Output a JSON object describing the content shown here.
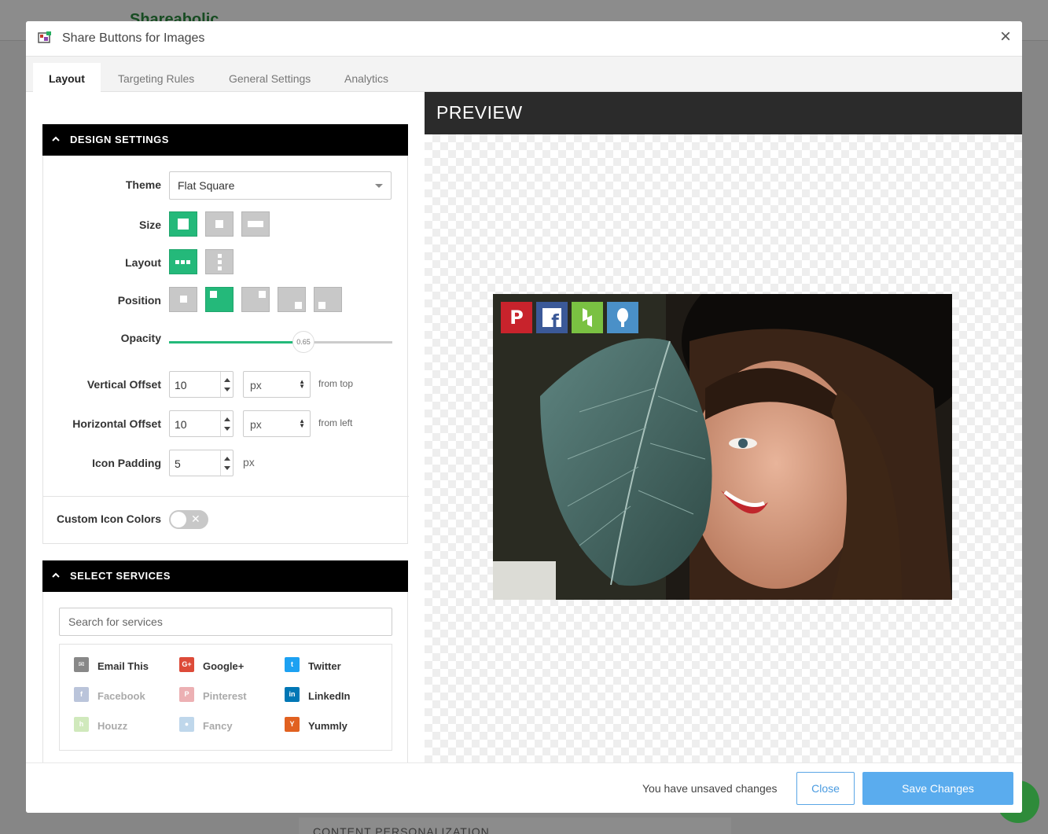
{
  "background": {
    "logo": "Shareabolic",
    "bottom_text": "CONTENT PERSONALIZATION"
  },
  "modal": {
    "title": "Share Buttons for Images",
    "tabs": [
      {
        "label": "Layout"
      },
      {
        "label": "Targeting Rules"
      },
      {
        "label": "General Settings"
      },
      {
        "label": "Analytics"
      }
    ],
    "active_tab": "Layout"
  },
  "design": {
    "header": "DESIGN SETTINGS",
    "theme_label": "Theme",
    "theme_value": "Flat Square",
    "size_label": "Size",
    "layout_label": "Layout",
    "position_label": "Position",
    "opacity_label": "Opacity",
    "opacity_value": "0.65",
    "vertical_offset_label": "Vertical Offset",
    "vertical_offset_value": "10",
    "vertical_offset_unit": "px",
    "vertical_offset_suffix": "from top",
    "horizontal_offset_label": "Horizontal Offset",
    "horizontal_offset_value": "10",
    "horizontal_offset_unit": "px",
    "horizontal_offset_suffix": "from left",
    "icon_padding_label": "Icon Padding",
    "icon_padding_value": "5",
    "icon_padding_unit": "px",
    "custom_colors_label": "Custom Icon Colors"
  },
  "services": {
    "header": "SELECT SERVICES",
    "search_placeholder": "Search for services",
    "items": [
      {
        "label": "Email This",
        "icon": "email-icon",
        "color": "#888888"
      },
      {
        "label": "Google+",
        "icon": "google-plus-icon",
        "color": "#dd4b39"
      },
      {
        "label": "Twitter",
        "icon": "twitter-icon",
        "color": "#1da1f2"
      },
      {
        "label": "Facebook",
        "icon": "facebook-icon",
        "color": "#3b5998"
      },
      {
        "label": "Pinterest",
        "icon": "pinterest-icon",
        "color": "#cb2027"
      },
      {
        "label": "LinkedIn",
        "icon": "linkedin-icon",
        "color": "#0077b5"
      },
      {
        "label": "Houzz",
        "icon": "houzz-icon",
        "color": "#7ac142"
      },
      {
        "label": "Fancy",
        "icon": "fancy-icon",
        "color": "#4a90c8"
      },
      {
        "label": "Yummly",
        "icon": "yummly-icon",
        "color": "#e16120"
      }
    ]
  },
  "preview": {
    "header": "PREVIEW",
    "share_icons": [
      {
        "icon": "pinterest-icon",
        "color": "#c8232c"
      },
      {
        "icon": "facebook-icon",
        "color": "#3b5998"
      },
      {
        "icon": "houzz-icon",
        "color": "#7ac142"
      },
      {
        "icon": "fancy-icon",
        "color": "#4a90c8"
      }
    ]
  },
  "footer": {
    "unsaved_text": "You have unsaved changes",
    "close_label": "Close",
    "save_label": "Save Changes"
  },
  "colors": {
    "accent_green": "#24b97a",
    "save_blue": "#5aacee"
  }
}
